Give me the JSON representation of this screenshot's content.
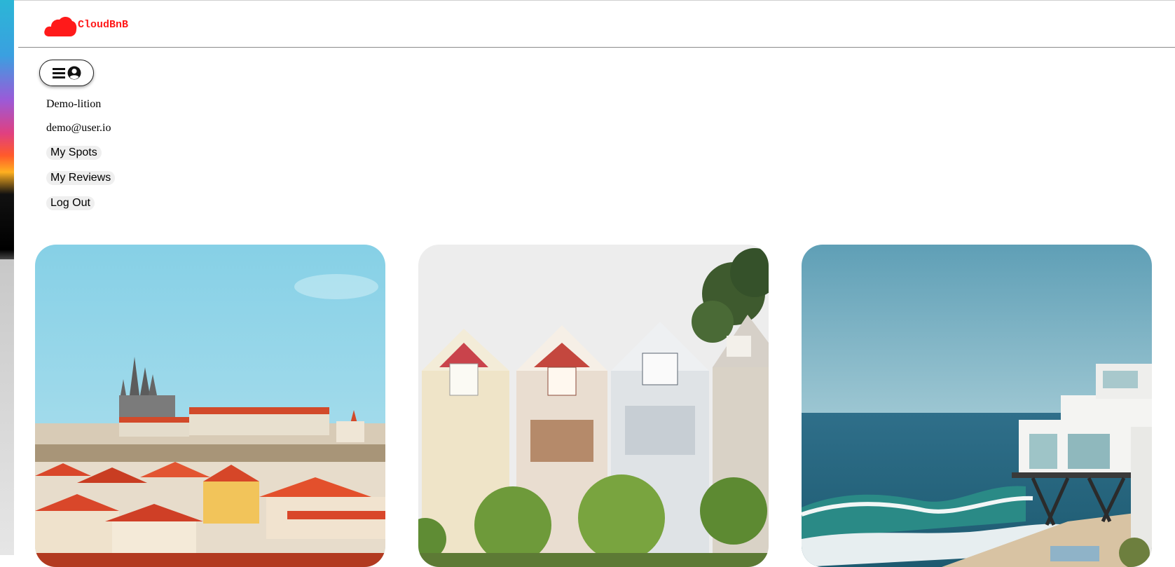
{
  "brand": {
    "name": "CloudBnB",
    "color": "#ff1a1a"
  },
  "menu": {
    "icon_menu": "hamburger-icon",
    "icon_user": "user-circle-icon"
  },
  "dropdown": {
    "username": "Demo-lition",
    "email": "demo@user.io",
    "my_spots": "My Spots",
    "my_reviews": "My Reviews",
    "log_out": "Log Out"
  },
  "spots": [
    {
      "scene": "hillside city with castle and red roofs"
    },
    {
      "scene": "row of painted victorian houses"
    },
    {
      "scene": "modern house on stilts over ocean beach"
    }
  ]
}
